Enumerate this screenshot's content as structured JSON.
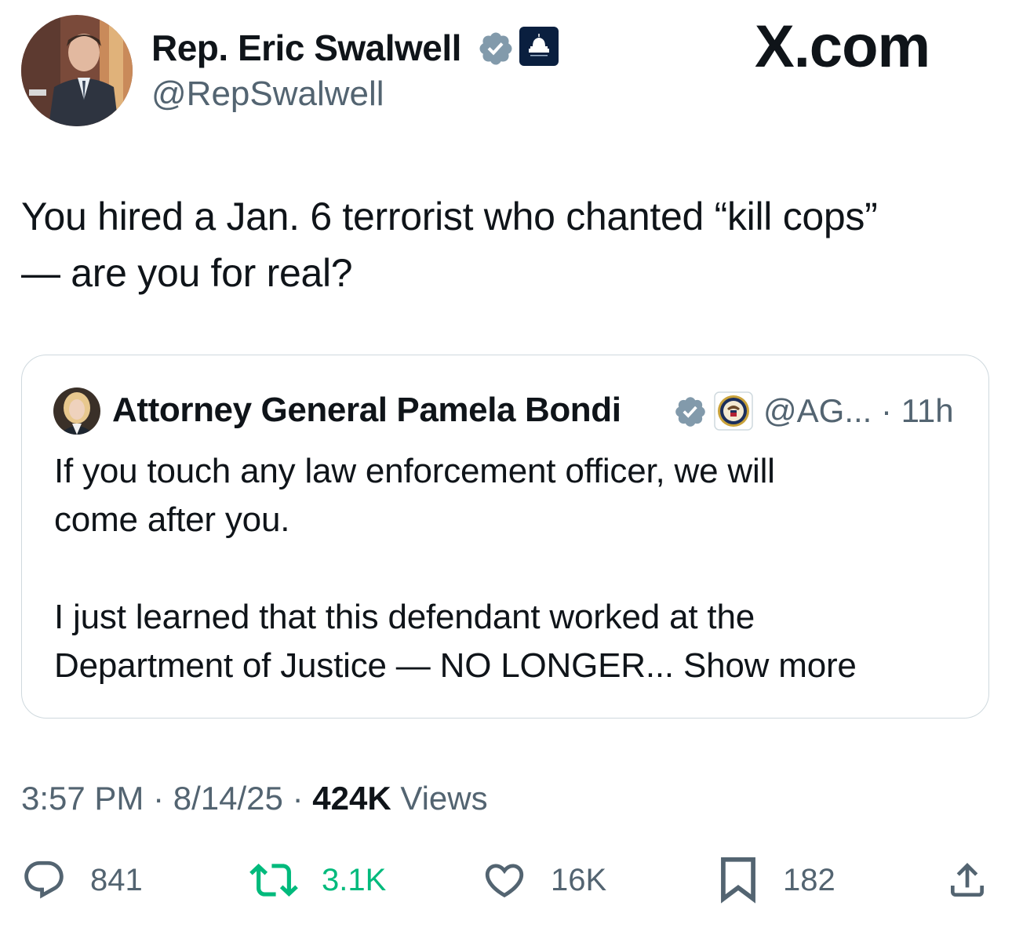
{
  "header": {
    "display_name": "Rep. Eric Swalwell",
    "handle": "@RepSwalwell",
    "site_label": "X.com",
    "verified_icon": "verified-badge-icon",
    "affiliation_icon": "house-democrats-capitol-icon"
  },
  "tweet": {
    "text": "You hired a Jan. 6 terrorist who chanted “kill cops”\n— are you for real?"
  },
  "quote": {
    "display_name": "Attorney General Pamela Bondi",
    "handle": "@AG...",
    "separator": "·",
    "time": "11h",
    "text": "If you touch any law enforcement officer, we will\ncome after you.\n\nI just learned that this defendant worked at the\nDepartment of Justice — NO LONGER...",
    "show_more": "Show more",
    "affiliation_icon": "doj-seal-icon"
  },
  "meta": {
    "time": "3:57 PM",
    "sep1": "·",
    "date": "8/14/25",
    "sep2": "·",
    "views_count": "424K",
    "views_label": "Views"
  },
  "actions": {
    "replies": "841",
    "reposts": "3.1K",
    "likes": "16K",
    "bookmarks": "182"
  },
  "colors": {
    "text": "#0f1419",
    "secondary": "#536471",
    "repost_active": "#00ba7c",
    "verified": "#829aab",
    "border": "#cfd9de"
  }
}
